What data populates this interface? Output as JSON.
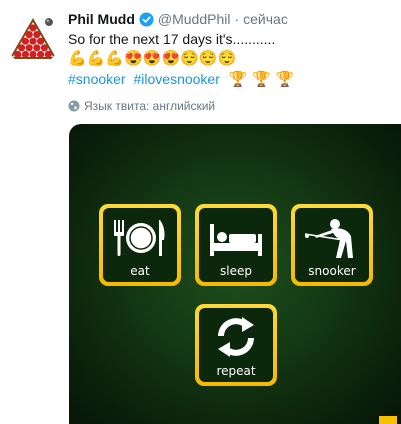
{
  "tweet": {
    "author_name": "Phil Mudd",
    "handle": "@MuddPhil",
    "separator": "·",
    "time": "сейчас",
    "text_line1": "So for the next 17 days it's...........",
    "emojis": [
      "💪",
      "💪",
      "💪",
      "😍",
      "😍",
      "😍",
      "😌",
      "😌",
      "😌"
    ],
    "hashtags": [
      "#snooker",
      "#ilovesnooker"
    ],
    "trophies": [
      "🏆",
      "🏆",
      "🏆"
    ],
    "language_label": "Язык твита: английский"
  },
  "media": {
    "tiles": [
      {
        "label": "eat",
        "icon": "plate-fork-knife-icon"
      },
      {
        "label": "sleep",
        "icon": "bed-icon"
      },
      {
        "label": "snooker",
        "icon": "snooker-player-icon"
      },
      {
        "label": "repeat",
        "icon": "repeat-arrows-icon"
      }
    ]
  },
  "colors": {
    "text": "#14171a",
    "muted": "#657786",
    "link": "#1b95e0",
    "verified": "#1da1f2",
    "tile_gold": "#f6b900",
    "background_green": "#143a14"
  }
}
